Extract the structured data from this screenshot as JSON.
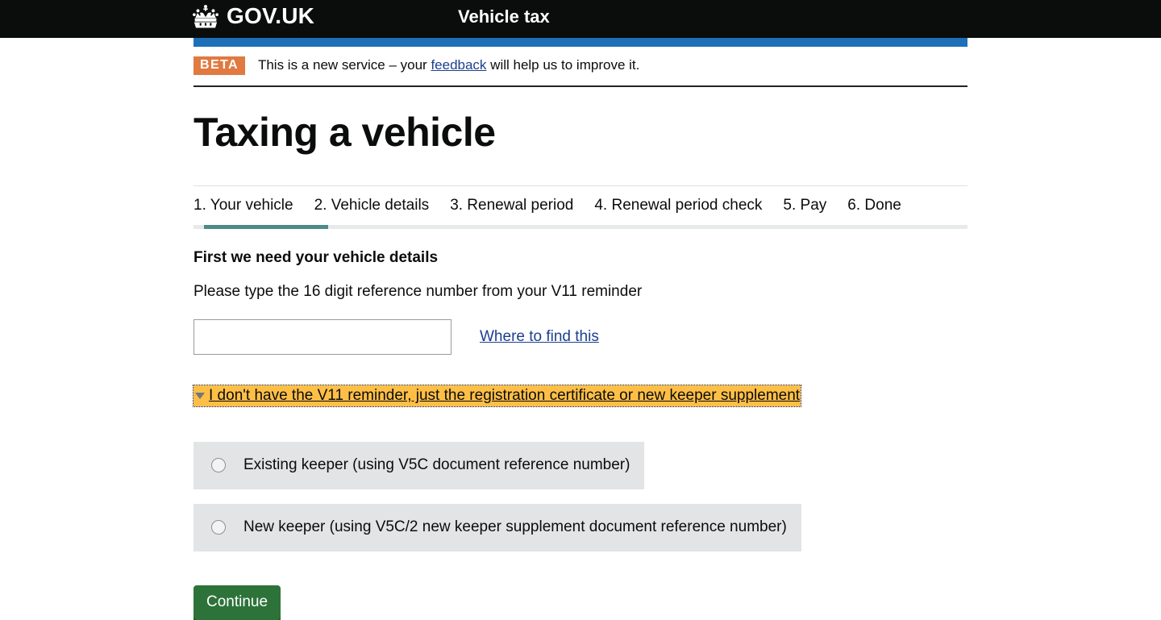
{
  "header": {
    "logo_text": "GOV.UK",
    "crown_icon": "crown-icon",
    "service_name": "Vehicle tax"
  },
  "phase_banner": {
    "tag": "BETA",
    "text_before": "This is a new service – your ",
    "link_text": "feedback",
    "text_after": " will help us to improve it."
  },
  "page": {
    "title": "Taxing a vehicle"
  },
  "steps": {
    "items": [
      {
        "label": "1. Your vehicle"
      },
      {
        "label": "2. Vehicle details"
      },
      {
        "label": "3. Renewal period"
      },
      {
        "label": "4. Renewal period check"
      },
      {
        "label": "5. Pay"
      },
      {
        "label": "6. Done"
      }
    ],
    "current_step": 1,
    "total_steps": 6,
    "progress_percent": "16",
    "progress_color": "#4d8b86",
    "track_color": "#e8e9ea"
  },
  "form": {
    "heading": "First we need your vehicle details",
    "hint": "Please type the 16 digit reference number from your V11 reminder",
    "reference_input": {
      "value": "",
      "placeholder": ""
    },
    "where_to_find_link": "Where to find this",
    "details": {
      "summary": "I don't have the V11 reminder, just the registration certificate or new keeper supplement",
      "state": "open",
      "marker_icon": "triangle-down-icon",
      "focus_color": "#ffbf47"
    },
    "radios": [
      {
        "label": "Existing keeper (using V5C document reference number)",
        "selected": false
      },
      {
        "label": "New keeper (using V5C/2 new keeper supplement document reference number)",
        "selected": false
      }
    ],
    "continue_button": "Continue",
    "button_color": "#2d7339"
  }
}
